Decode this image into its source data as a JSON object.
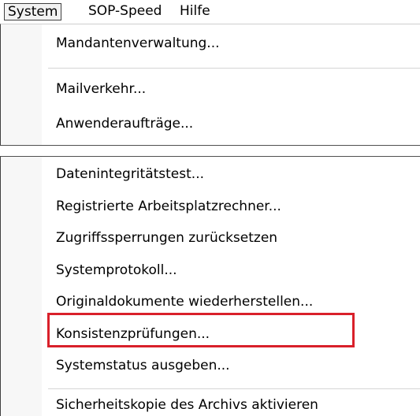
{
  "menubar": {
    "items": [
      {
        "label": "System"
      },
      {
        "label": "SOP-Speed"
      },
      {
        "label": "Hilfe"
      }
    ]
  },
  "system_menu": {
    "group1": [
      {
        "label": "Mandantenverwaltung..."
      }
    ],
    "group2": [
      {
        "label": "Mailverkehr..."
      },
      {
        "label": "Anwenderaufträge..."
      }
    ],
    "group3": [
      {
        "label": "Datenintegritätstest..."
      },
      {
        "label": "Registrierte Arbeitsplatzrechner..."
      },
      {
        "label": "Zugriffssperrungen zurücksetzen"
      },
      {
        "label": "Systemprotokoll..."
      },
      {
        "label": "Originaldokumente wiederherstellen..."
      },
      {
        "label": "Konsistenzprüfungen..."
      },
      {
        "label": "Systemstatus ausgeben..."
      }
    ],
    "group4": [
      {
        "label": "Sicherheitskopie des Archivs aktivieren"
      }
    ]
  },
  "highlight": {
    "item": "Konsistenzprüfungen...",
    "color": "#d9202a"
  }
}
